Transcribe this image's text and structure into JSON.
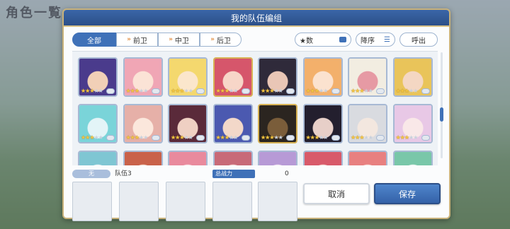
{
  "background": {
    "screen_title": "角色一覧"
  },
  "dialog": {
    "title": "我的队伍编组",
    "filter_tabs": [
      {
        "label": "全部",
        "selected": true
      },
      {
        "label": "前卫",
        "selected": false
      },
      {
        "label": "中卫",
        "selected": false
      },
      {
        "label": "后卫",
        "selected": false
      }
    ],
    "sort_field": "★数",
    "order_label": "降序",
    "call_label": "呼出",
    "characters": [
      {
        "colors": [
          "#4a3b8c",
          "#f1d0b7"
        ],
        "stars": 3
      },
      {
        "colors": [
          "#f0a6b5",
          "#fbe3d6"
        ],
        "stars": 3
      },
      {
        "colors": [
          "#f4d86e",
          "#fbe6cc"
        ],
        "stars": 3
      },
      {
        "colors": [
          "#d6566b",
          "#f7d6c8"
        ],
        "stars": 3
      },
      {
        "colors": [
          "#2f2a3a",
          "#e9c6b6"
        ],
        "stars": 3
      },
      {
        "colors": [
          "#f3b06b",
          "#fbe2cf"
        ],
        "stars": 3
      },
      {
        "colors": [
          "#f2ede1",
          "#e69aa4"
        ],
        "stars": 3
      },
      {
        "colors": [
          "#e9c45a",
          "#f4d7c3"
        ],
        "stars": 3
      },
      {
        "colors": [
          "#7ad4d9",
          "#e3f4f7"
        ],
        "stars": 3
      },
      {
        "colors": [
          "#e6b0a8",
          "#fbe7dc"
        ],
        "stars": 3
      },
      {
        "colors": [
          "#5a2a3a",
          "#efd0c3"
        ],
        "stars": 3
      },
      {
        "colors": [
          "#4b59b0",
          "#f3d8c9"
        ],
        "stars": 3
      },
      {
        "colors": [
          "#2b2520",
          "#7a5d3a"
        ],
        "stars": 3
      },
      {
        "colors": [
          "#231f2e",
          "#e7cfc8"
        ],
        "stars": 3
      },
      {
        "colors": [
          "#d9dbe0",
          "#f3e7df"
        ],
        "stars": 3
      },
      {
        "colors": [
          "#e8c8e6",
          "#f9e8e8"
        ],
        "stars": 3
      },
      {
        "colors": [
          "#7fc6d3",
          "#e9f2f4"
        ],
        "stars": 3
      },
      {
        "colors": [
          "#c9624a",
          "#f2d3c4"
        ],
        "stars": 3
      },
      {
        "colors": [
          "#e98a9d",
          "#f9dfe3"
        ],
        "stars": 3
      },
      {
        "colors": [
          "#c86a78",
          "#f3d2cf"
        ],
        "stars": 3
      },
      {
        "colors": [
          "#b79ad6",
          "#f2e4f2"
        ],
        "stars": 3
      },
      {
        "colors": [
          "#d85a6a",
          "#f5d3cd"
        ],
        "stars": 3
      },
      {
        "colors": [
          "#e88080",
          "#f8ddd8"
        ],
        "stars": 3
      },
      {
        "colors": [
          "#79c7a9",
          "#e6f3ed"
        ],
        "stars": 3
      }
    ],
    "team": {
      "tag": "无",
      "name": "队伍3",
      "power_label": "总战力",
      "power_value": "0"
    },
    "buttons": {
      "cancel": "取消",
      "save": "保存"
    }
  },
  "colors": {
    "accent": "#3f71b8",
    "frame_gold": "#c9b27a"
  }
}
